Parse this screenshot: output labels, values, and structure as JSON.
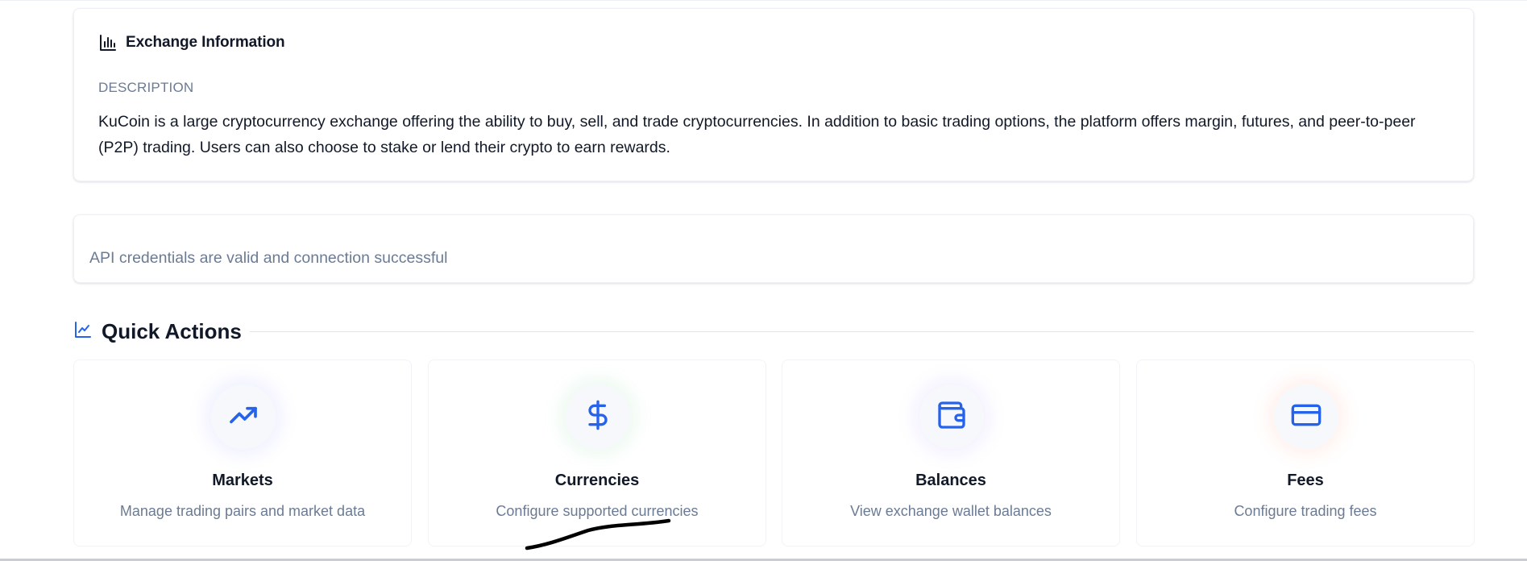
{
  "exchange_info": {
    "title": "Exchange Information",
    "title_icon": "bar-chart-icon",
    "description_label": "DESCRIPTION",
    "description_text": "KuCoin is a large cryptocurrency exchange offering the ability to buy, sell, and trade cryptocurrencies. In addition to basic trading options, the platform offers margin, futures, and peer-to-peer (P2P) trading. Users can also choose to stake or lend their crypto to earn rewards."
  },
  "connection_status": {
    "message": "API credentials are valid and connection successful"
  },
  "quick_actions": {
    "title": "Quick Actions",
    "title_icon": "line-chart-icon",
    "accent_color": "#2563eb",
    "items": [
      {
        "title": "Markets",
        "description": "Manage trading pairs and market data",
        "icon": "trending-up-icon",
        "glow": "blue"
      },
      {
        "title": "Currencies",
        "description": "Configure supported currencies",
        "icon": "dollar-sign-icon",
        "glow": "green"
      },
      {
        "title": "Balances",
        "description": "View exchange wallet balances",
        "icon": "wallet-icon",
        "glow": "purple"
      },
      {
        "title": "Fees",
        "description": "Configure trading fees",
        "icon": "credit-card-icon",
        "glow": "orange"
      }
    ]
  }
}
